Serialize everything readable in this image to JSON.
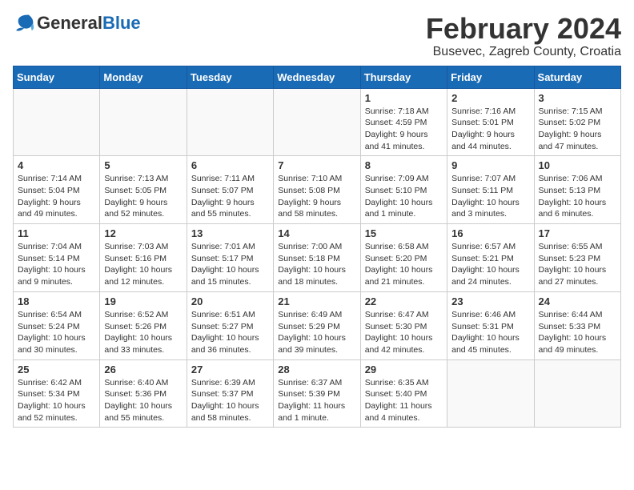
{
  "header": {
    "logo_general": "General",
    "logo_blue": "Blue",
    "month_year": "February 2024",
    "location": "Busevec, Zagreb County, Croatia"
  },
  "weekdays": [
    "Sunday",
    "Monday",
    "Tuesday",
    "Wednesday",
    "Thursday",
    "Friday",
    "Saturday"
  ],
  "weeks": [
    [
      {
        "day": "",
        "sunrise": "",
        "sunset": "",
        "daylight": ""
      },
      {
        "day": "",
        "sunrise": "",
        "sunset": "",
        "daylight": ""
      },
      {
        "day": "",
        "sunrise": "",
        "sunset": "",
        "daylight": ""
      },
      {
        "day": "",
        "sunrise": "",
        "sunset": "",
        "daylight": ""
      },
      {
        "day": "1",
        "sunrise": "Sunrise: 7:18 AM",
        "sunset": "Sunset: 4:59 PM",
        "daylight": "Daylight: 9 hours and 41 minutes."
      },
      {
        "day": "2",
        "sunrise": "Sunrise: 7:16 AM",
        "sunset": "Sunset: 5:01 PM",
        "daylight": "Daylight: 9 hours and 44 minutes."
      },
      {
        "day": "3",
        "sunrise": "Sunrise: 7:15 AM",
        "sunset": "Sunset: 5:02 PM",
        "daylight": "Daylight: 9 hours and 47 minutes."
      }
    ],
    [
      {
        "day": "4",
        "sunrise": "Sunrise: 7:14 AM",
        "sunset": "Sunset: 5:04 PM",
        "daylight": "Daylight: 9 hours and 49 minutes."
      },
      {
        "day": "5",
        "sunrise": "Sunrise: 7:13 AM",
        "sunset": "Sunset: 5:05 PM",
        "daylight": "Daylight: 9 hours and 52 minutes."
      },
      {
        "day": "6",
        "sunrise": "Sunrise: 7:11 AM",
        "sunset": "Sunset: 5:07 PM",
        "daylight": "Daylight: 9 hours and 55 minutes."
      },
      {
        "day": "7",
        "sunrise": "Sunrise: 7:10 AM",
        "sunset": "Sunset: 5:08 PM",
        "daylight": "Daylight: 9 hours and 58 minutes."
      },
      {
        "day": "8",
        "sunrise": "Sunrise: 7:09 AM",
        "sunset": "Sunset: 5:10 PM",
        "daylight": "Daylight: 10 hours and 1 minute."
      },
      {
        "day": "9",
        "sunrise": "Sunrise: 7:07 AM",
        "sunset": "Sunset: 5:11 PM",
        "daylight": "Daylight: 10 hours and 3 minutes."
      },
      {
        "day": "10",
        "sunrise": "Sunrise: 7:06 AM",
        "sunset": "Sunset: 5:13 PM",
        "daylight": "Daylight: 10 hours and 6 minutes."
      }
    ],
    [
      {
        "day": "11",
        "sunrise": "Sunrise: 7:04 AM",
        "sunset": "Sunset: 5:14 PM",
        "daylight": "Daylight: 10 hours and 9 minutes."
      },
      {
        "day": "12",
        "sunrise": "Sunrise: 7:03 AM",
        "sunset": "Sunset: 5:16 PM",
        "daylight": "Daylight: 10 hours and 12 minutes."
      },
      {
        "day": "13",
        "sunrise": "Sunrise: 7:01 AM",
        "sunset": "Sunset: 5:17 PM",
        "daylight": "Daylight: 10 hours and 15 minutes."
      },
      {
        "day": "14",
        "sunrise": "Sunrise: 7:00 AM",
        "sunset": "Sunset: 5:18 PM",
        "daylight": "Daylight: 10 hours and 18 minutes."
      },
      {
        "day": "15",
        "sunrise": "Sunrise: 6:58 AM",
        "sunset": "Sunset: 5:20 PM",
        "daylight": "Daylight: 10 hours and 21 minutes."
      },
      {
        "day": "16",
        "sunrise": "Sunrise: 6:57 AM",
        "sunset": "Sunset: 5:21 PM",
        "daylight": "Daylight: 10 hours and 24 minutes."
      },
      {
        "day": "17",
        "sunrise": "Sunrise: 6:55 AM",
        "sunset": "Sunset: 5:23 PM",
        "daylight": "Daylight: 10 hours and 27 minutes."
      }
    ],
    [
      {
        "day": "18",
        "sunrise": "Sunrise: 6:54 AM",
        "sunset": "Sunset: 5:24 PM",
        "daylight": "Daylight: 10 hours and 30 minutes."
      },
      {
        "day": "19",
        "sunrise": "Sunrise: 6:52 AM",
        "sunset": "Sunset: 5:26 PM",
        "daylight": "Daylight: 10 hours and 33 minutes."
      },
      {
        "day": "20",
        "sunrise": "Sunrise: 6:51 AM",
        "sunset": "Sunset: 5:27 PM",
        "daylight": "Daylight: 10 hours and 36 minutes."
      },
      {
        "day": "21",
        "sunrise": "Sunrise: 6:49 AM",
        "sunset": "Sunset: 5:29 PM",
        "daylight": "Daylight: 10 hours and 39 minutes."
      },
      {
        "day": "22",
        "sunrise": "Sunrise: 6:47 AM",
        "sunset": "Sunset: 5:30 PM",
        "daylight": "Daylight: 10 hours and 42 minutes."
      },
      {
        "day": "23",
        "sunrise": "Sunrise: 6:46 AM",
        "sunset": "Sunset: 5:31 PM",
        "daylight": "Daylight: 10 hours and 45 minutes."
      },
      {
        "day": "24",
        "sunrise": "Sunrise: 6:44 AM",
        "sunset": "Sunset: 5:33 PM",
        "daylight": "Daylight: 10 hours and 49 minutes."
      }
    ],
    [
      {
        "day": "25",
        "sunrise": "Sunrise: 6:42 AM",
        "sunset": "Sunset: 5:34 PM",
        "daylight": "Daylight: 10 hours and 52 minutes."
      },
      {
        "day": "26",
        "sunrise": "Sunrise: 6:40 AM",
        "sunset": "Sunset: 5:36 PM",
        "daylight": "Daylight: 10 hours and 55 minutes."
      },
      {
        "day": "27",
        "sunrise": "Sunrise: 6:39 AM",
        "sunset": "Sunset: 5:37 PM",
        "daylight": "Daylight: 10 hours and 58 minutes."
      },
      {
        "day": "28",
        "sunrise": "Sunrise: 6:37 AM",
        "sunset": "Sunset: 5:39 PM",
        "daylight": "Daylight: 11 hours and 1 minute."
      },
      {
        "day": "29",
        "sunrise": "Sunrise: 6:35 AM",
        "sunset": "Sunset: 5:40 PM",
        "daylight": "Daylight: 11 hours and 4 minutes."
      },
      {
        "day": "",
        "sunrise": "",
        "sunset": "",
        "daylight": ""
      },
      {
        "day": "",
        "sunrise": "",
        "sunset": "",
        "daylight": ""
      }
    ]
  ]
}
